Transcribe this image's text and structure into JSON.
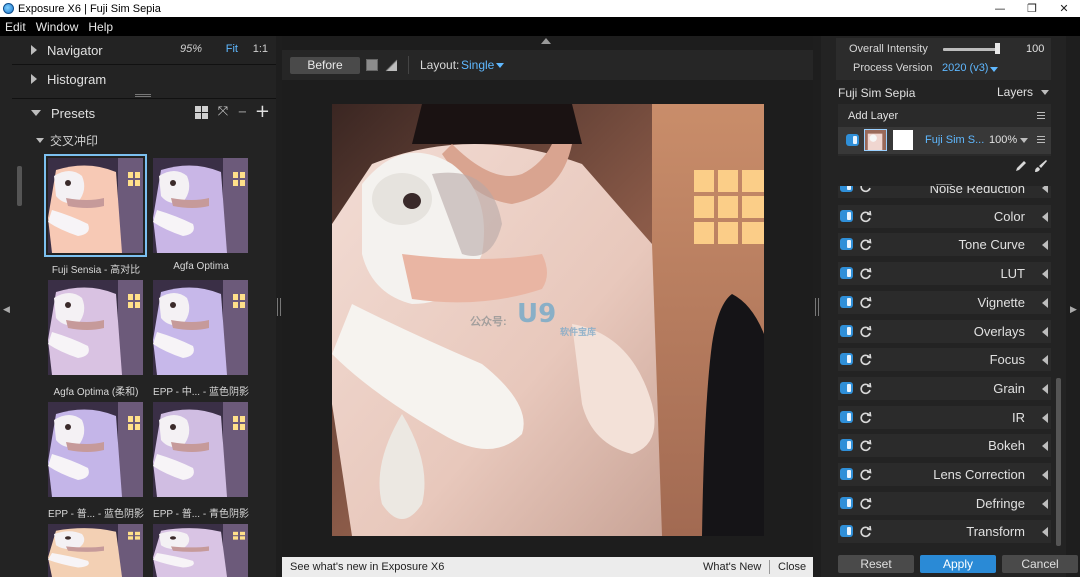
{
  "window": {
    "title": "Exposure X6 | Fuji Sim Sepia",
    "controls": [
      "—",
      "❐",
      "✕"
    ]
  },
  "menu": [
    "Edit",
    "Window",
    "Help"
  ],
  "left_panel": {
    "navigator": {
      "label": "Navigator",
      "zoom": "95%",
      "fit": "Fit",
      "one_to_one": "1:1"
    },
    "histogram": {
      "label": "Histogram"
    },
    "presets": {
      "label": "Presets",
      "group": "交叉冲印",
      "items": [
        {
          "label": "Fuji Sensia - 高对比",
          "selected": true
        },
        {
          "label": "Agfa Optima",
          "selected": false
        },
        {
          "label": "Agfa Optima (柔和)",
          "selected": false
        },
        {
          "label": "EPP - 中... - 蓝色阴影",
          "selected": false
        },
        {
          "label": "EPP - 普... - 蓝色阴影",
          "selected": false
        },
        {
          "label": "EPP - 普... - 青色阴影",
          "selected": false
        },
        {
          "label": "",
          "selected": false
        },
        {
          "label": "",
          "selected": false
        }
      ]
    }
  },
  "center": {
    "before_label": "Before",
    "layout_label": "Layout:",
    "layout_value": "Single",
    "watermark": {
      "small": "公众号:",
      "big": "U9",
      "sub": "软件宝库"
    },
    "bottom_bar": {
      "message": "See what's new in Exposure X6",
      "whats_new": "What's New",
      "close": "Close"
    }
  },
  "right_panel": {
    "overall_intensity_label": "Overall Intensity",
    "overall_intensity_value": "100",
    "overall_intensity_level": 1.0,
    "process_version_label": "Process Version",
    "process_version_value": "2020 (v3)",
    "preset_name": "Fuji Sim Sepia",
    "layers_label": "Layers",
    "add_layer_label": "Add Layer",
    "layer": {
      "name": "Fuji Sim S...",
      "opacity": "100%"
    },
    "adjustments": [
      "Noise Reduction",
      "Color",
      "Tone Curve",
      "LUT",
      "Vignette",
      "Overlays",
      "Focus",
      "Grain",
      "IR",
      "Bokeh",
      "Lens Correction",
      "Defringe",
      "Transform"
    ],
    "buttons": {
      "reset": "Reset",
      "apply": "Apply",
      "cancel": "Cancel"
    }
  },
  "colors": {
    "accent": "#5fb8ff",
    "apply": "#2a8ad6",
    "panel": "#232323"
  },
  "icons": [
    "app-icon",
    "grid-view-icon",
    "collapse-icon",
    "minus-icon",
    "plus-icon",
    "square-icon",
    "split-view-icon",
    "hamburger-icon",
    "pencil-icon",
    "brush-icon",
    "reset-icon",
    "toggle-icon"
  ]
}
